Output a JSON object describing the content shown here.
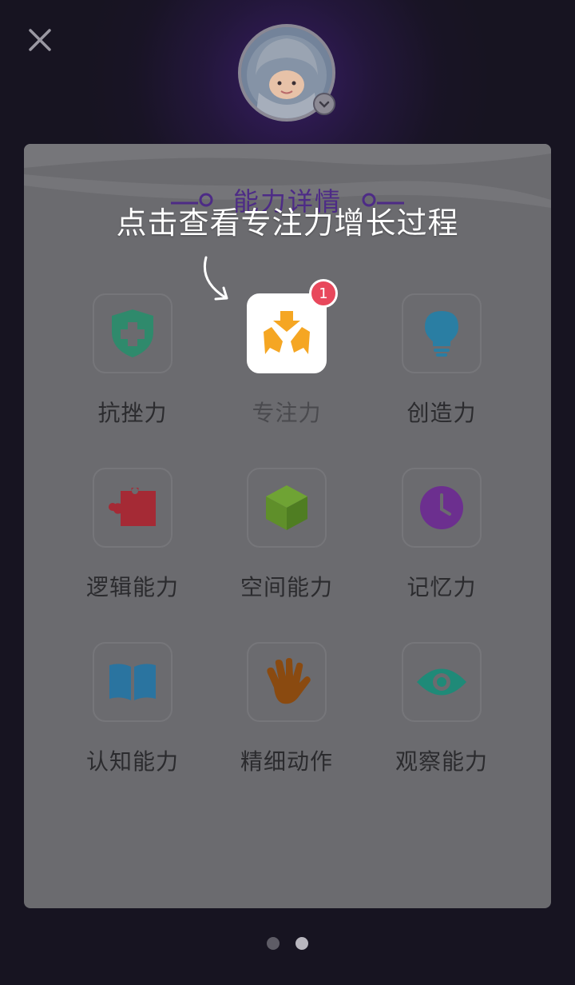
{
  "header": {
    "close_icon": "close-icon",
    "avatar_badge_icon": "chevron-down-icon"
  },
  "panel": {
    "title": "能力详情"
  },
  "hint": {
    "text": "点击查看专注力增长过程"
  },
  "abilities": [
    {
      "label": "抗挫力",
      "icon": "shield-plus-icon",
      "color": "#2f8a6c",
      "active": false
    },
    {
      "label": "专注力",
      "icon": "focus-arrows-icon",
      "color": "#f5a623",
      "active": true,
      "badge": "1"
    },
    {
      "label": "创造力",
      "icon": "lightbulb-icon",
      "color": "#2a7ea3",
      "active": false
    },
    {
      "label": "逻辑能力",
      "icon": "puzzle-icon",
      "color": "#a52a35",
      "active": false
    },
    {
      "label": "空间能力",
      "icon": "cube-icon",
      "color": "#5f8f2a",
      "active": false
    },
    {
      "label": "记忆力",
      "icon": "clock-icon",
      "color": "#6c2f8f",
      "active": false
    },
    {
      "label": "认知能力",
      "icon": "book-icon",
      "color": "#2a74a0",
      "active": false
    },
    {
      "label": "精细动作",
      "icon": "hand-icon",
      "color": "#8a4a10",
      "active": false
    },
    {
      "label": "观察能力",
      "icon": "eye-icon",
      "color": "#1f8a78",
      "active": false
    }
  ],
  "pagination": {
    "total": 2,
    "current": 2
  }
}
